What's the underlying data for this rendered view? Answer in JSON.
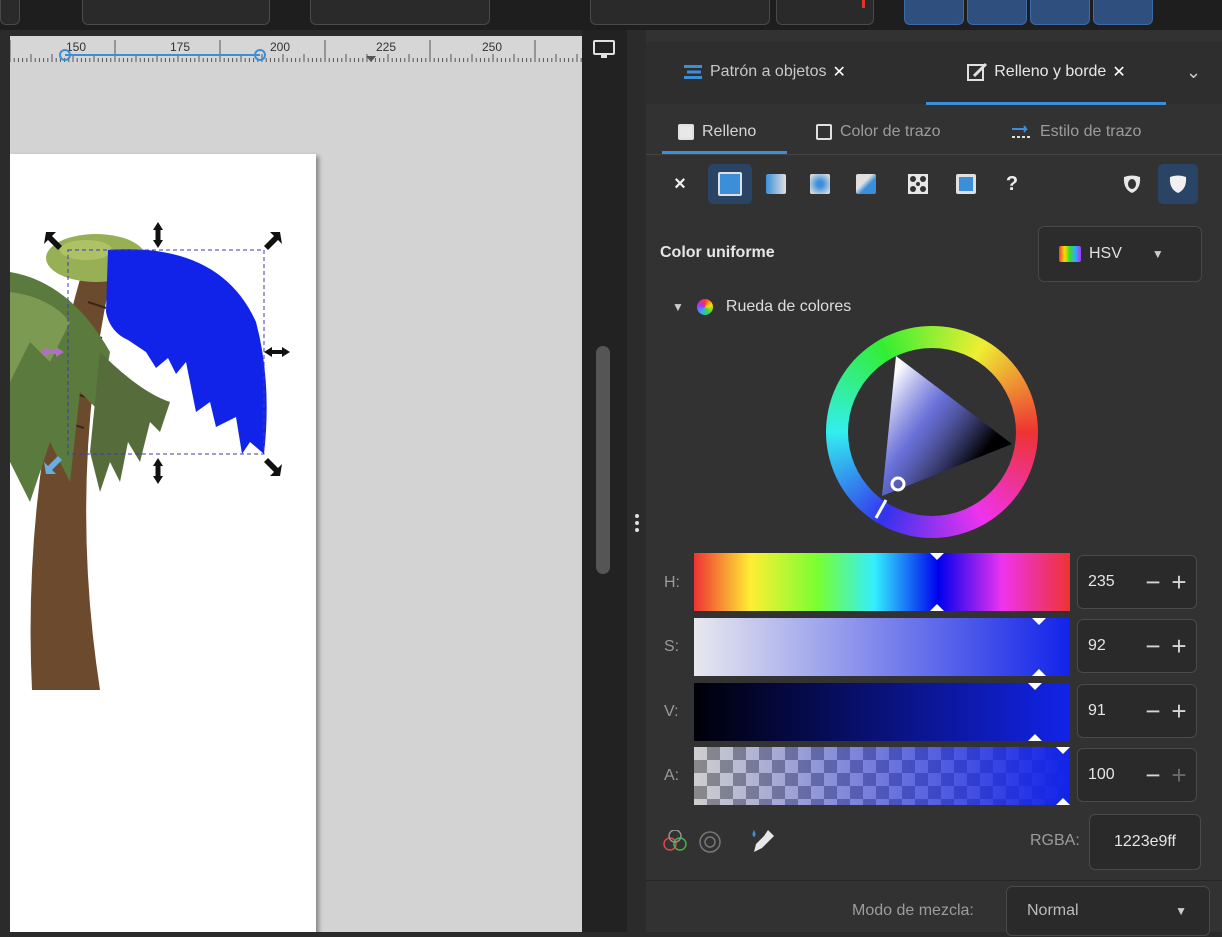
{
  "ruler": {
    "labels": [
      "150",
      "175",
      "200",
      "225",
      "250"
    ]
  },
  "panel": {
    "tabs": [
      {
        "label": "Patrón a objetos",
        "icon": "pattern-objects-icon"
      },
      {
        "label": "Relleno y borde",
        "icon": "fill-stroke-icon"
      }
    ],
    "subtabs": [
      {
        "label": "Relleno"
      },
      {
        "label": "Color de trazo"
      },
      {
        "label": "Estilo de trazo"
      }
    ],
    "paint_types": [
      "no-paint",
      "flat-color",
      "linear-gradient",
      "radial-gradient",
      "mesh-gradient",
      "pattern",
      "swatch",
      "unset"
    ],
    "paint_unknown_symbol": "?",
    "paint_none_symbol": "×",
    "section_title": "Color uniforme",
    "color_mode": "HSV",
    "wheel_label": "Rueda de colores",
    "sliders": [
      {
        "label": "H:",
        "value": "235"
      },
      {
        "label": "S:",
        "value": "92"
      },
      {
        "label": "V:",
        "value": "91"
      },
      {
        "label": "A:",
        "value": "100"
      }
    ],
    "rgba_label": "RGBA:",
    "rgba_value": "1223e9ff",
    "blend_label": "Modo de mezcla:",
    "blend_value": "Normal"
  },
  "colors": {
    "selected_fill": "#1223e9",
    "accent": "#3b8fd9"
  }
}
